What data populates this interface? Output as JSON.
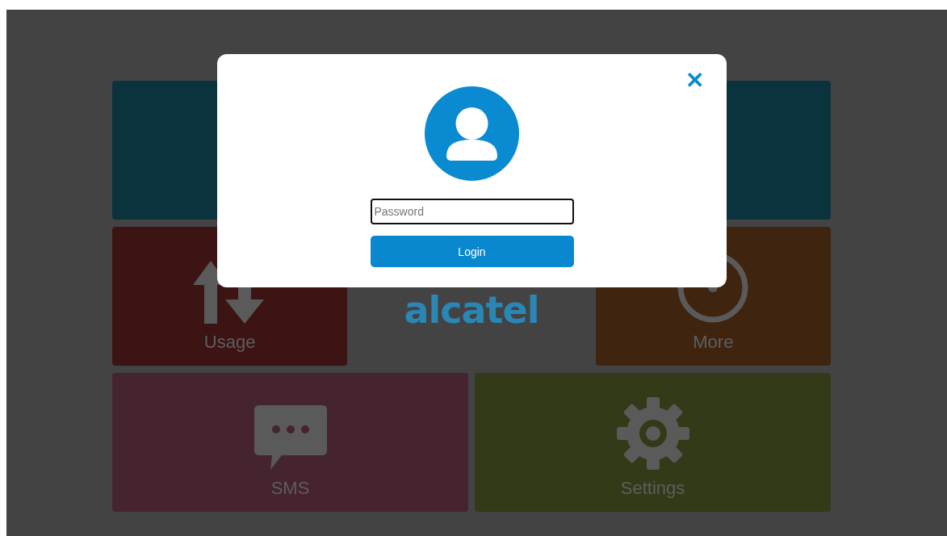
{
  "tiles": [
    {
      "kind": "blank",
      "color": "#0b333d"
    },
    {
      "kind": "blank",
      "color": "#0b333d"
    },
    {
      "kind": "usage",
      "label": "Usage",
      "color": "#3d1414"
    },
    {
      "kind": "logo",
      "label": "alcatel"
    },
    {
      "kind": "more",
      "label": "More",
      "color": "#3f2510"
    },
    {
      "kind": "sms",
      "label": "SMS",
      "color": "#45232f"
    },
    {
      "kind": "settings",
      "label": "Settings",
      "color": "#323a17"
    }
  ],
  "login_dialog": {
    "close": "✕",
    "password": {
      "placeholder": "Password"
    },
    "login_button": "Login"
  }
}
